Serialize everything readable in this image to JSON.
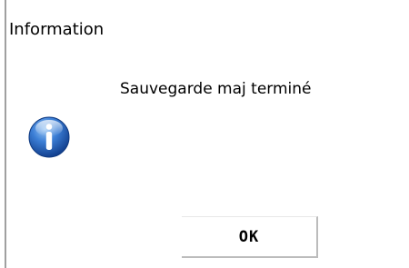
{
  "dialog": {
    "title": "Information",
    "message": "Sauvegarde maj terminé",
    "icon": "info-icon",
    "ok_label": "OK"
  },
  "colors": {
    "icon_blue": "#1e63c4",
    "border": "#a0a0a0"
  }
}
